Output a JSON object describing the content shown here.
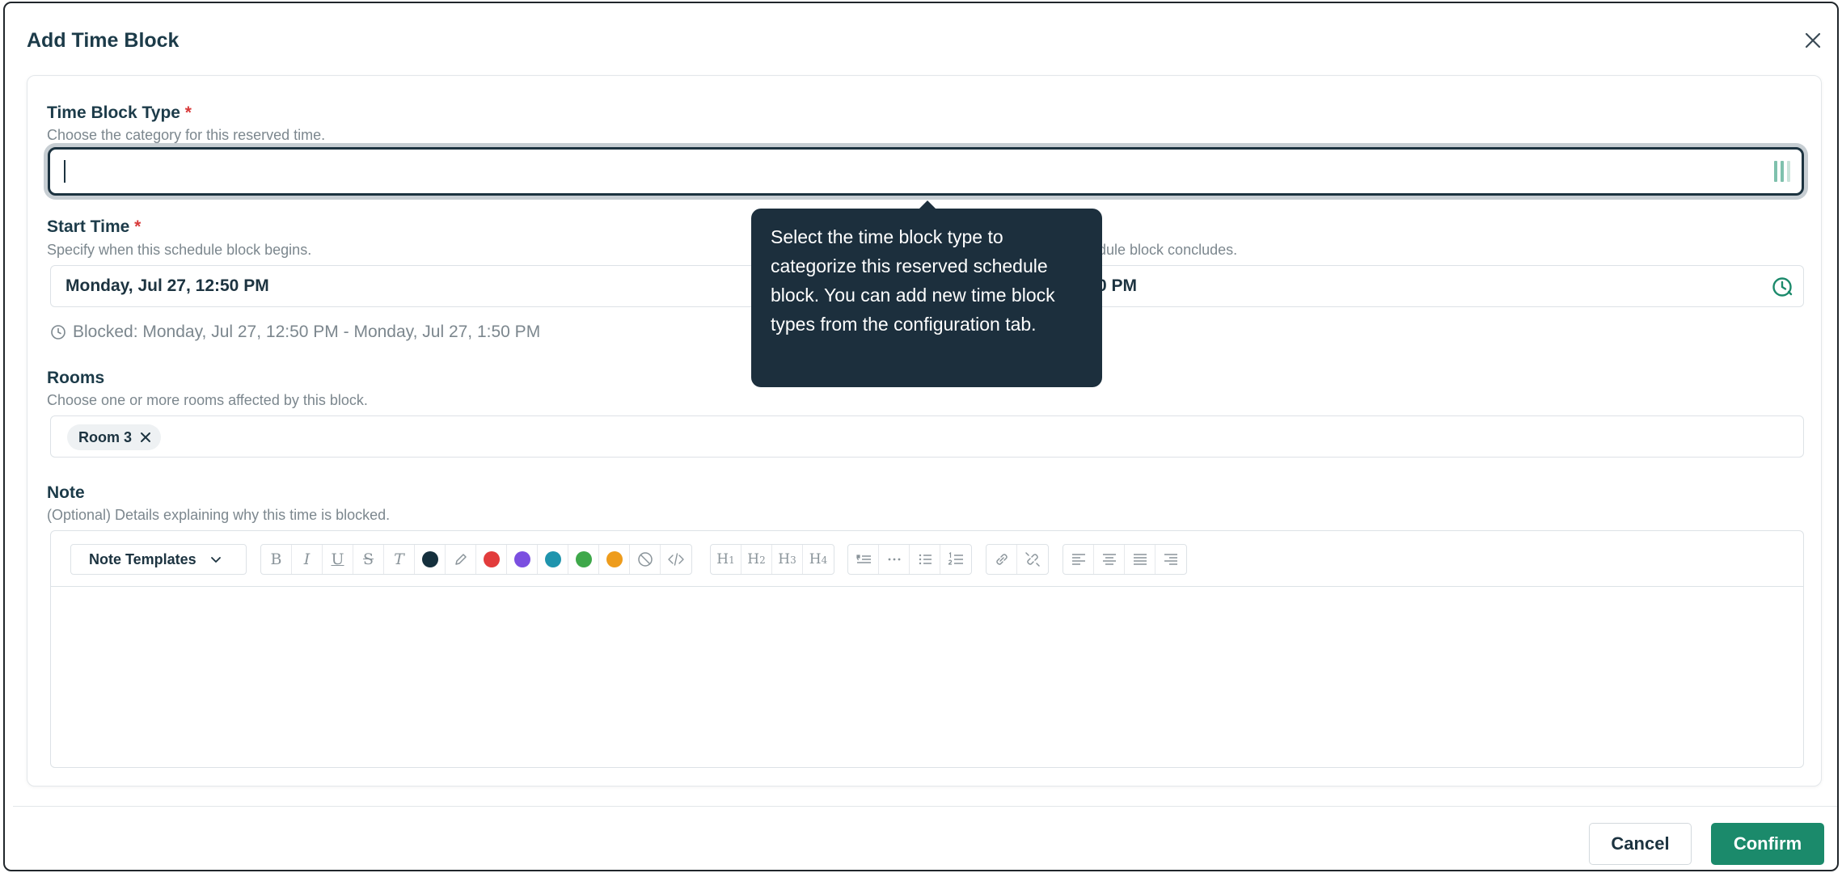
{
  "modal": {
    "title": "Add Time Block"
  },
  "time_block_type": {
    "label": "Time Block Type",
    "required_mark": "*",
    "hint": "Choose the category for this reserved time.",
    "value": ""
  },
  "start_time": {
    "label": "Start Time",
    "required_mark": "*",
    "hint": "Specify when this schedule block begins.",
    "value": "Monday, Jul 27, 12:50 PM"
  },
  "end_time": {
    "hint_visible": "dule block concludes.",
    "value_visible": "0 PM"
  },
  "blocked_summary": "Blocked: Monday, Jul 27, 12:50 PM - Monday, Jul 27, 1:50 PM",
  "rooms": {
    "label": "Rooms",
    "hint": "Choose one or more rooms affected by this block.",
    "chips": [
      "Room 3"
    ]
  },
  "note": {
    "label": "Note",
    "hint": "(Optional) Details explaining why this time is blocked.",
    "templates_label": "Note Templates",
    "toolbar_glyphs": {
      "bold": "B",
      "italic": "I",
      "underline": "U",
      "strike": "S",
      "clear": "T",
      "h1": "H",
      "h2": "H",
      "h3": "H",
      "h4": "H"
    },
    "colors": [
      "#15303d",
      "#e23c3c",
      "#7b4fe0",
      "#1f94ad",
      "#3ea84a",
      "#ee9c1c"
    ]
  },
  "tooltip": {
    "text": "Select the time block type to categorize this reserved schedule block. You can add new time block types from the configuration tab."
  },
  "footer": {
    "cancel_label": "Cancel",
    "confirm_label": "Confirm"
  },
  "colors": {
    "accent": "#1b8a6b",
    "dark": "#1c2f3d",
    "required": "#d83a3a"
  }
}
